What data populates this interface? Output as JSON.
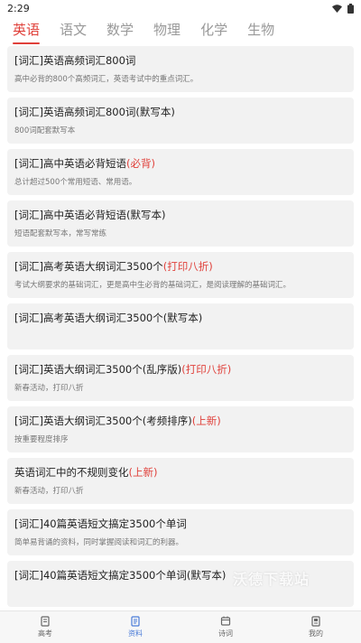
{
  "status": {
    "time": "2:29"
  },
  "tabs": [
    {
      "label": "英语",
      "active": true
    },
    {
      "label": "语文",
      "active": false
    },
    {
      "label": "数学",
      "active": false
    },
    {
      "label": "物理",
      "active": false
    },
    {
      "label": "化学",
      "active": false
    },
    {
      "label": "生物",
      "active": false
    }
  ],
  "items": [
    {
      "title": "[词汇]英语高频词汇800词",
      "tag": "",
      "desc": "高中必背的800个高频词汇，英语考试中的重点词汇。"
    },
    {
      "title": "[词汇]英语高频词汇800词(默写本)",
      "tag": "",
      "desc": "800词配套默写本"
    },
    {
      "title": "[词汇]高中英语必背短语",
      "tag": "(必背)",
      "desc": "总计超过500个常用短语、常用语。"
    },
    {
      "title": "[词汇]高中英语必背短语(默写本)",
      "tag": "",
      "desc": "短语配套默写本，常写常练"
    },
    {
      "title": "[词汇]高考英语大纲词汇3500个",
      "tag": "(打印八折)",
      "desc": "考试大纲要求的基础词汇，更是高中生必背的基础词汇，是阅读理解的基础词汇。"
    },
    {
      "title": "[词汇]高考英语大纲词汇3500个(默写本)",
      "tag": "",
      "desc": ""
    },
    {
      "title": "[词汇]英语大纲词汇3500个(乱序版)",
      "tag": "(打印八折)",
      "desc": "新春活动，打印八折"
    },
    {
      "title": "[词汇]英语大纲词汇3500个(考频排序)",
      "tag": "(上新)",
      "desc": "按重要程度排序"
    },
    {
      "title": "英语词汇中的不规则变化",
      "tag": "(上新)",
      "desc": "新春活动，打印八折"
    },
    {
      "title": "[词汇]40篇英语短文搞定3500个单词",
      "tag": "",
      "desc": "简单易背诵的资料，同时掌握阅读和词汇的利器。"
    },
    {
      "title": "[词汇]40篇英语短文搞定3500个单词(默写本)",
      "tag": "",
      "desc": ""
    }
  ],
  "watermark": "沃德下载站",
  "nav": [
    {
      "label": "高考",
      "icon": "book-icon",
      "active": false
    },
    {
      "label": "资料",
      "icon": "document-icon",
      "active": true
    },
    {
      "label": "诗词",
      "icon": "poem-icon",
      "active": false
    },
    {
      "label": "我的",
      "icon": "profile-icon",
      "active": false
    }
  ],
  "colors": {
    "accent": "#e0403a",
    "nav_active": "#4a7bd8",
    "card_bg": "#f2f2f2"
  }
}
